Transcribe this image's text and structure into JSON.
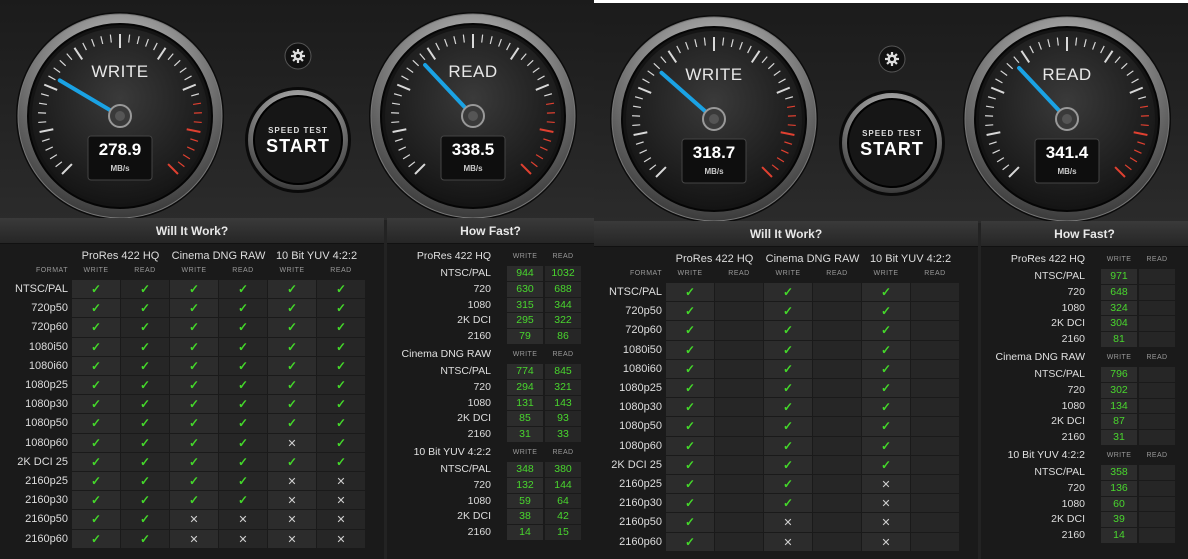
{
  "colors": {
    "accent_needle": "#1aa2e4",
    "check_green": "#44d82a",
    "redline": "#e04030"
  },
  "panels": [
    {
      "write_gauge": {
        "title": "WRITE",
        "value": "278.9",
        "unit": "MB/s",
        "needle_fraction": 0.28
      },
      "read_gauge": {
        "title": "READ",
        "value": "338.5",
        "unit": "MB/s",
        "needle_fraction": 0.34
      },
      "settings_icon": "gear-icon",
      "start_button": {
        "small": "SPEED TEST",
        "big": "START"
      },
      "will_it_work": {
        "title": "Will It Work?",
        "format_label": "FORMAT",
        "codecs": [
          "ProRes 422 HQ",
          "Cinema DNG RAW",
          "10 Bit YUV 4:2:2"
        ],
        "sub_write": "WRITE",
        "sub_read": "READ",
        "rows": [
          {
            "fmt": "NTSC/PAL",
            "marks": [
              "y",
              "y",
              "y",
              "y",
              "y",
              "y"
            ]
          },
          {
            "fmt": "720p50",
            "marks": [
              "y",
              "y",
              "y",
              "y",
              "y",
              "y"
            ]
          },
          {
            "fmt": "720p60",
            "marks": [
              "y",
              "y",
              "y",
              "y",
              "y",
              "y"
            ]
          },
          {
            "fmt": "1080i50",
            "marks": [
              "y",
              "y",
              "y",
              "y",
              "y",
              "y"
            ]
          },
          {
            "fmt": "1080i60",
            "marks": [
              "y",
              "y",
              "y",
              "y",
              "y",
              "y"
            ]
          },
          {
            "fmt": "1080p25",
            "marks": [
              "y",
              "y",
              "y",
              "y",
              "y",
              "y"
            ]
          },
          {
            "fmt": "1080p30",
            "marks": [
              "y",
              "y",
              "y",
              "y",
              "y",
              "y"
            ]
          },
          {
            "fmt": "1080p50",
            "marks": [
              "y",
              "y",
              "y",
              "y",
              "y",
              "y"
            ]
          },
          {
            "fmt": "1080p60",
            "marks": [
              "y",
              "y",
              "y",
              "y",
              "n",
              "y"
            ]
          },
          {
            "fmt": "2K DCI 25",
            "marks": [
              "y",
              "y",
              "y",
              "y",
              "y",
              "y"
            ]
          },
          {
            "fmt": "2160p25",
            "marks": [
              "y",
              "y",
              "y",
              "y",
              "n",
              "n"
            ]
          },
          {
            "fmt": "2160p30",
            "marks": [
              "y",
              "y",
              "y",
              "y",
              "n",
              "n"
            ]
          },
          {
            "fmt": "2160p50",
            "marks": [
              "y",
              "y",
              "n",
              "n",
              "n",
              "n"
            ]
          },
          {
            "fmt": "2160p60",
            "marks": [
              "y",
              "y",
              "n",
              "n",
              "n",
              "n"
            ]
          }
        ]
      },
      "how_fast": {
        "title": "How Fast?",
        "sub_write": "WRITE",
        "sub_read": "READ",
        "groups": [
          {
            "name": "ProRes 422 HQ",
            "rows": [
              {
                "label": "NTSC/PAL",
                "w": "944",
                "r": "1032"
              },
              {
                "label": "720",
                "w": "630",
                "r": "688"
              },
              {
                "label": "1080",
                "w": "315",
                "r": "344"
              },
              {
                "label": "2K DCI",
                "w": "295",
                "r": "322"
              },
              {
                "label": "2160",
                "w": "79",
                "r": "86"
              }
            ]
          },
          {
            "name": "Cinema DNG RAW",
            "rows": [
              {
                "label": "NTSC/PAL",
                "w": "774",
                "r": "845"
              },
              {
                "label": "720",
                "w": "294",
                "r": "321"
              },
              {
                "label": "1080",
                "w": "131",
                "r": "143"
              },
              {
                "label": "2K DCI",
                "w": "85",
                "r": "93"
              },
              {
                "label": "2160",
                "w": "31",
                "r": "33"
              }
            ]
          },
          {
            "name": "10 Bit YUV 4:2:2",
            "rows": [
              {
                "label": "NTSC/PAL",
                "w": "348",
                "r": "380"
              },
              {
                "label": "720",
                "w": "132",
                "r": "144"
              },
              {
                "label": "1080",
                "w": "59",
                "r": "64"
              },
              {
                "label": "2K DCI",
                "w": "38",
                "r": "42"
              },
              {
                "label": "2160",
                "w": "14",
                "r": "15"
              }
            ]
          }
        ]
      }
    },
    {
      "write_gauge": {
        "title": "WRITE",
        "value": "318.7",
        "unit": "MB/s",
        "needle_fraction": 0.32
      },
      "read_gauge": {
        "title": "READ",
        "value": "341.4",
        "unit": "MB/s",
        "needle_fraction": 0.34
      },
      "settings_icon": "gear-icon",
      "start_button": {
        "small": "SPEED TEST",
        "big": "START"
      },
      "will_it_work": {
        "title": "Will It Work?",
        "format_label": "FORMAT",
        "codecs": [
          "ProRes 422 HQ",
          "Cinema DNG RAW",
          "10 Bit YUV 4:2:2"
        ],
        "sub_write": "WRITE",
        "sub_read": "READ",
        "rows": [
          {
            "fmt": "NTSC/PAL",
            "marks": [
              "y",
              "",
              "y",
              "",
              "y",
              ""
            ]
          },
          {
            "fmt": "720p50",
            "marks": [
              "y",
              "",
              "y",
              "",
              "y",
              ""
            ]
          },
          {
            "fmt": "720p60",
            "marks": [
              "y",
              "",
              "y",
              "",
              "y",
              ""
            ]
          },
          {
            "fmt": "1080i50",
            "marks": [
              "y",
              "",
              "y",
              "",
              "y",
              ""
            ]
          },
          {
            "fmt": "1080i60",
            "marks": [
              "y",
              "",
              "y",
              "",
              "y",
              ""
            ]
          },
          {
            "fmt": "1080p25",
            "marks": [
              "y",
              "",
              "y",
              "",
              "y",
              ""
            ]
          },
          {
            "fmt": "1080p30",
            "marks": [
              "y",
              "",
              "y",
              "",
              "y",
              ""
            ]
          },
          {
            "fmt": "1080p50",
            "marks": [
              "y",
              "",
              "y",
              "",
              "y",
              ""
            ]
          },
          {
            "fmt": "1080p60",
            "marks": [
              "y",
              "",
              "y",
              "",
              "y",
              ""
            ]
          },
          {
            "fmt": "2K DCI 25",
            "marks": [
              "y",
              "",
              "y",
              "",
              "y",
              ""
            ]
          },
          {
            "fmt": "2160p25",
            "marks": [
              "y",
              "",
              "y",
              "",
              "n",
              ""
            ]
          },
          {
            "fmt": "2160p30",
            "marks": [
              "y",
              "",
              "y",
              "",
              "n",
              ""
            ]
          },
          {
            "fmt": "2160p50",
            "marks": [
              "y",
              "",
              "n",
              "",
              "n",
              ""
            ]
          },
          {
            "fmt": "2160p60",
            "marks": [
              "y",
              "",
              "n",
              "",
              "n",
              ""
            ]
          }
        ]
      },
      "how_fast": {
        "title": "How Fast?",
        "sub_write": "WRITE",
        "sub_read": "READ",
        "groups": [
          {
            "name": "ProRes 422 HQ",
            "rows": [
              {
                "label": "NTSC/PAL",
                "w": "971",
                "r": ""
              },
              {
                "label": "720",
                "w": "648",
                "r": ""
              },
              {
                "label": "1080",
                "w": "324",
                "r": ""
              },
              {
                "label": "2K DCI",
                "w": "304",
                "r": ""
              },
              {
                "label": "2160",
                "w": "81",
                "r": ""
              }
            ]
          },
          {
            "name": "Cinema DNG RAW",
            "rows": [
              {
                "label": "NTSC/PAL",
                "w": "796",
                "r": ""
              },
              {
                "label": "720",
                "w": "302",
                "r": ""
              },
              {
                "label": "1080",
                "w": "134",
                "r": ""
              },
              {
                "label": "2K DCI",
                "w": "87",
                "r": ""
              },
              {
                "label": "2160",
                "w": "31",
                "r": ""
              }
            ]
          },
          {
            "name": "10 Bit YUV 4:2:2",
            "rows": [
              {
                "label": "NTSC/PAL",
                "w": "358",
                "r": ""
              },
              {
                "label": "720",
                "w": "136",
                "r": ""
              },
              {
                "label": "1080",
                "w": "60",
                "r": ""
              },
              {
                "label": "2K DCI",
                "w": "39",
                "r": ""
              },
              {
                "label": "2160",
                "w": "14",
                "r": ""
              }
            ]
          }
        ]
      }
    }
  ]
}
